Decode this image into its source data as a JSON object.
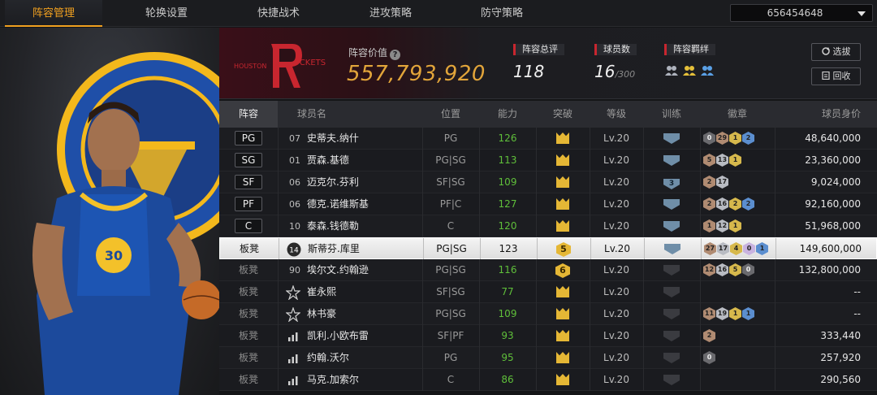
{
  "nav": {
    "tabs": [
      "阵容管理",
      "轮换设置",
      "快捷战术",
      "进攻策略",
      "防守策略"
    ],
    "active_index": 0,
    "account": "656454648"
  },
  "team": {
    "logo_text": "HOUSTON ROCKETS",
    "logo_text_left": "HOUSTON",
    "logo_text_right": "ROCKETS",
    "value_label": "阵容价值",
    "value": "557,793,920",
    "rating_label": "阵容总评",
    "rating": "118",
    "players_label": "球员数",
    "players_count": "16",
    "players_max": "/300",
    "bonds_label": "阵容羁绊",
    "buttons": {
      "select": "选拔",
      "recycle": "回收"
    }
  },
  "table": {
    "headers": [
      "阵容",
      "球员名",
      "位置",
      "能力",
      "突破",
      "等级",
      "训练",
      "徽章",
      "球员身价"
    ],
    "rows": [
      {
        "slot": "PG",
        "num": "07",
        "name": "史蒂夫.纳什",
        "pos": "PG",
        "ability": "126",
        "breakthrough": "",
        "level": "Lv.20",
        "training": "",
        "badges": [
          {
            "c": "dark",
            "v": "0"
          },
          {
            "c": "bronze",
            "v": "29"
          },
          {
            "c": "gold",
            "v": "1"
          },
          {
            "c": "blue",
            "v": "2"
          }
        ],
        "worth": "48,640,000"
      },
      {
        "slot": "SG",
        "num": "01",
        "name": "贾森.基德",
        "pos": "PG|SG",
        "ability": "113",
        "breakthrough": "",
        "level": "Lv.20",
        "training": "",
        "badges": [
          {
            "c": "bronze",
            "v": "5"
          },
          {
            "c": "silver",
            "v": "13"
          },
          {
            "c": "gold",
            "v": "1"
          }
        ],
        "worth": "23,360,000"
      },
      {
        "slot": "SF",
        "num": "06",
        "name": "迈克尔.芬利",
        "pos": "SF|SG",
        "ability": "109",
        "breakthrough": "",
        "level": "Lv.20",
        "training": "3",
        "badges": [
          {
            "c": "bronze",
            "v": "2"
          },
          {
            "c": "silver",
            "v": "17"
          }
        ],
        "worth": "9,024,000"
      },
      {
        "slot": "PF",
        "num": "06",
        "name": "德克.诺维斯基",
        "pos": "PF|C",
        "ability": "127",
        "breakthrough": "",
        "level": "Lv.20",
        "training": "",
        "badges": [
          {
            "c": "bronze",
            "v": "2"
          },
          {
            "c": "silver",
            "v": "16"
          },
          {
            "c": "gold",
            "v": "2"
          },
          {
            "c": "blue",
            "v": "2"
          }
        ],
        "worth": "92,160,000"
      },
      {
        "slot": "C",
        "num": "10",
        "name": "泰森.钱德勒",
        "pos": "C",
        "ability": "120",
        "breakthrough": "",
        "level": "Lv.20",
        "training": "",
        "badges": [
          {
            "c": "bronze",
            "v": "1"
          },
          {
            "c": "silver",
            "v": "12"
          },
          {
            "c": "gold",
            "v": "1"
          }
        ],
        "worth": "51,968,000"
      },
      {
        "slot": "板凳",
        "num": "",
        "icon_num": "14",
        "name": "斯蒂芬.库里",
        "pos": "PG|SG",
        "ability": "123",
        "breakthrough": "5",
        "level": "Lv.20",
        "training": "",
        "badges": [
          {
            "c": "bronze",
            "v": "27"
          },
          {
            "c": "silver",
            "v": "17"
          },
          {
            "c": "gold",
            "v": "4"
          },
          {
            "c": "purple",
            "v": "0"
          },
          {
            "c": "blue",
            "v": "1"
          }
        ],
        "worth": "149,600,000",
        "selected": true
      },
      {
        "slot": "板凳",
        "num": "90",
        "name": "埃尔文.约翰逊",
        "pos": "PG|SG",
        "ability": "116",
        "breakthrough": "6",
        "level": "Lv.20",
        "training": "off",
        "badges": [
          {
            "c": "bronze",
            "v": "12"
          },
          {
            "c": "silver",
            "v": "16"
          },
          {
            "c": "gold",
            "v": "5"
          },
          {
            "c": "dark",
            "v": "0"
          }
        ],
        "worth": "132,800,000"
      },
      {
        "slot": "板凳",
        "num": "",
        "name": "崔永熙",
        "pos": "SF|SG",
        "ability": "77",
        "breakthrough": "",
        "level": "Lv.20",
        "training": "off",
        "badges": [],
        "worth": "--"
      },
      {
        "slot": "板凳",
        "num": "",
        "name": "林书豪",
        "pos": "PG|SG",
        "ability": "109",
        "breakthrough": "",
        "level": "Lv.20",
        "training": "off",
        "badges": [
          {
            "c": "bronze",
            "v": "11"
          },
          {
            "c": "silver",
            "v": "19"
          },
          {
            "c": "gold",
            "v": "1"
          },
          {
            "c": "blue",
            "v": "1"
          }
        ],
        "worth": "--"
      },
      {
        "slot": "板凳",
        "num": "",
        "name": "凯利.小欧布雷",
        "pos": "SF|PF",
        "ability": "93",
        "breakthrough": "",
        "level": "Lv.20",
        "training": "off",
        "badges": [
          {
            "c": "bronze",
            "v": "2"
          }
        ],
        "worth": "333,440"
      },
      {
        "slot": "板凳",
        "num": "",
        "name": "约翰.沃尔",
        "pos": "PG",
        "ability": "95",
        "breakthrough": "",
        "level": "Lv.20",
        "training": "off",
        "badges": [
          {
            "c": "dark",
            "v": "0"
          }
        ],
        "worth": "257,920"
      },
      {
        "slot": "板凳",
        "num": "",
        "name": "马克.加索尔",
        "pos": "C",
        "ability": "86",
        "breakthrough": "",
        "level": "Lv.20",
        "training": "off",
        "badges": [],
        "worth": "290,560"
      }
    ]
  },
  "colors": {
    "accent": "#f0a020",
    "value": "#e2a53a",
    "ability": "#5fbf3a",
    "rocket_red": "#c8262f"
  }
}
